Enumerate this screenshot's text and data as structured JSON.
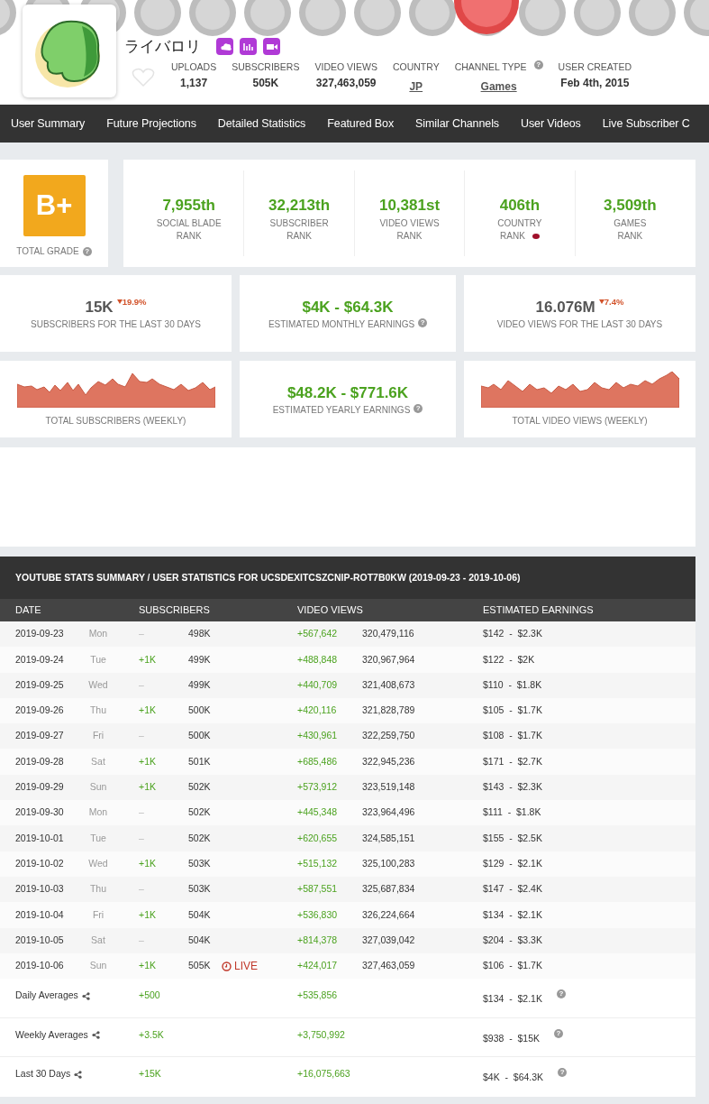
{
  "channel": {
    "name": "ライバロリ",
    "stats": [
      {
        "label": "UPLOADS",
        "value": "1,137",
        "kind": "plain"
      },
      {
        "label": "SUBSCRIBERS",
        "value": "505K",
        "kind": "plain"
      },
      {
        "label": "VIDEO VIEWS",
        "value": "327,463,059",
        "kind": "plain"
      },
      {
        "label": "COUNTRY",
        "value": "JP",
        "kind": "link"
      },
      {
        "label": "CHANNEL TYPE",
        "value": "Games",
        "kind": "link",
        "help": "?"
      },
      {
        "label": "USER CREATED",
        "value": "Feb 4th, 2015",
        "kind": "plain"
      }
    ]
  },
  "nav": [
    "User Summary",
    "Future Projections",
    "Detailed Statistics",
    "Featured Box",
    "Similar Channels",
    "User Videos",
    "Live Subscriber C"
  ],
  "grade": {
    "value": "B+",
    "label": "TOTAL GRADE",
    "help": "?"
  },
  "ranks": [
    {
      "value": "7,955th",
      "lines": [
        "SOCIAL BLADE",
        "RANK"
      ],
      "flag": false
    },
    {
      "value": "32,213th",
      "lines": [
        "SUBSCRIBER",
        "RANK"
      ],
      "flag": false
    },
    {
      "value": "10,381st",
      "lines": [
        "VIDEO VIEWS",
        "RANK"
      ],
      "flag": false
    },
    {
      "value": "406th",
      "lines": [
        "COUNTRY",
        "RANK"
      ],
      "flag": true
    },
    {
      "value": "3,509th",
      "lines": [
        "GAMES",
        "RANK"
      ],
      "flag": false
    }
  ],
  "cards": [
    {
      "kind": "stat",
      "value": "15K",
      "falling": true,
      "change": "19.9%",
      "label": "SUBSCRIBERS FOR THE LAST 30 DAYS"
    },
    {
      "kind": "earnings",
      "value": "$4K - $64.3K",
      "label": "ESTIMATED MONTHLY EARNINGS",
      "help": "?"
    },
    {
      "kind": "stat",
      "value": "16.076M",
      "falling": true,
      "change": "7.4%",
      "label": "VIDEO VIEWS FOR THE LAST 30 DAYS"
    },
    {
      "kind": "sparkline",
      "label": "TOTAL SUBSCRIBERS (WEEKLY)"
    },
    {
      "kind": "earnings",
      "value": "$48.2K - $771.6K",
      "label": "ESTIMATED YEARLY EARNINGS",
      "help": "?"
    },
    {
      "kind": "sparkline",
      "label": "TOTAL VIDEO VIEWS (WEEKLY)"
    }
  ],
  "table": {
    "title": "YOUTUBE STATS SUMMARY / USER STATISTICS FOR UCSDEXITCSZCNIP-ROT7B0KW (2019-09-23 - 2019-10-06)",
    "columns": [
      "DATE",
      "SUBSCRIBERS",
      "VIDEO VIEWS",
      "ESTIMATED EARNINGS"
    ],
    "rows": [
      {
        "date": "2019-09-23",
        "day": "Mon",
        "sub_change": "–",
        "grew": false,
        "subscribers": "498K",
        "views_change": "+567,642",
        "views": "320,479,116",
        "earnings": "$142  -  $2.3K"
      },
      {
        "date": "2019-09-24",
        "day": "Tue",
        "sub_change": "+1K",
        "grew": true,
        "subscribers": "499K",
        "views_change": "+488,848",
        "views": "320,967,964",
        "earnings": "$122  -  $2K"
      },
      {
        "date": "2019-09-25",
        "day": "Wed",
        "sub_change": "–",
        "grew": false,
        "subscribers": "499K",
        "views_change": "+440,709",
        "views": "321,408,673",
        "earnings": "$110  -  $1.8K"
      },
      {
        "date": "2019-09-26",
        "day": "Thu",
        "sub_change": "+1K",
        "grew": true,
        "subscribers": "500K",
        "views_change": "+420,116",
        "views": "321,828,789",
        "earnings": "$105  -  $1.7K"
      },
      {
        "date": "2019-09-27",
        "day": "Fri",
        "sub_change": "–",
        "grew": false,
        "subscribers": "500K",
        "views_change": "+430,961",
        "views": "322,259,750",
        "earnings": "$108  -  $1.7K"
      },
      {
        "date": "2019-09-28",
        "day": "Sat",
        "sub_change": "+1K",
        "grew": true,
        "subscribers": "501K",
        "views_change": "+685,486",
        "views": "322,945,236",
        "earnings": "$171  -  $2.7K"
      },
      {
        "date": "2019-09-29",
        "day": "Sun",
        "sub_change": "+1K",
        "grew": true,
        "subscribers": "502K",
        "views_change": "+573,912",
        "views": "323,519,148",
        "earnings": "$143  -  $2.3K"
      },
      {
        "date": "2019-09-30",
        "day": "Mon",
        "sub_change": "–",
        "grew": false,
        "subscribers": "502K",
        "views_change": "+445,348",
        "views": "323,964,496",
        "earnings": "$111  -  $1.8K"
      },
      {
        "date": "2019-10-01",
        "day": "Tue",
        "sub_change": "–",
        "grew": false,
        "subscribers": "502K",
        "views_change": "+620,655",
        "views": "324,585,151",
        "earnings": "$155  -  $2.5K"
      },
      {
        "date": "2019-10-02",
        "day": "Wed",
        "sub_change": "+1K",
        "grew": true,
        "subscribers": "503K",
        "views_change": "+515,132",
        "views": "325,100,283",
        "earnings": "$129  -  $2.1K"
      },
      {
        "date": "2019-10-03",
        "day": "Thu",
        "sub_change": "–",
        "grew": false,
        "subscribers": "503K",
        "views_change": "+587,551",
        "views": "325,687,834",
        "earnings": "$147  -  $2.4K"
      },
      {
        "date": "2019-10-04",
        "day": "Fri",
        "sub_change": "+1K",
        "grew": true,
        "subscribers": "504K",
        "views_change": "+536,830",
        "views": "326,224,664",
        "earnings": "$134  -  $2.1K"
      },
      {
        "date": "2019-10-05",
        "day": "Sat",
        "sub_change": "–",
        "grew": false,
        "subscribers": "504K",
        "views_change": "+814,378",
        "views": "327,039,042",
        "earnings": "$204  -  $3.3K"
      },
      {
        "date": "2019-10-06",
        "day": "Sun",
        "sub_change": "+1K",
        "grew": true,
        "subscribers": "505K",
        "live": "LIVE",
        "views_change": "+424,017",
        "views": "327,463,059",
        "earnings": "$106  -  $1.7K"
      }
    ],
    "averages": [
      {
        "label": "Daily Averages",
        "subscribers": "+500",
        "views": "+535,856",
        "earnings": "$134  -  $2.1K",
        "help": "?"
      },
      {
        "label": "Weekly Averages",
        "subscribers": "+3.5K",
        "views": "+3,750,992",
        "earnings": "$938  -  $15K",
        "help": "?"
      },
      {
        "label": "Last 30 Days",
        "subscribers": "+15K",
        "views": "+16,075,663",
        "earnings": "$4K  -  $64.3K",
        "help": "?"
      }
    ]
  }
}
